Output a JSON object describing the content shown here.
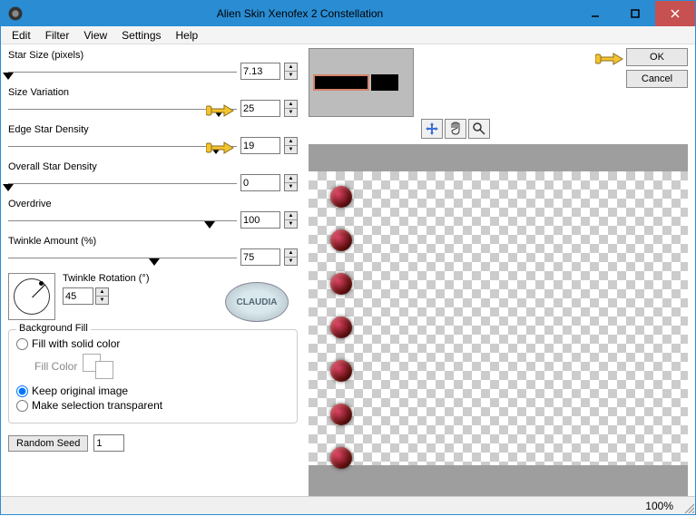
{
  "window": {
    "title": "Alien Skin Xenofex 2 Constellation"
  },
  "menu": {
    "edit": "Edit",
    "filter": "Filter",
    "view": "View",
    "settings": "Settings",
    "help": "Help"
  },
  "sliders": {
    "star_size": {
      "label": "Star Size (pixels)",
      "value": "7.13",
      "pos": 0
    },
    "size_variation": {
      "label": "Size Variation",
      "value": "25",
      "pos": 92
    },
    "edge_density": {
      "label": "Edge Star Density",
      "value": "19",
      "pos": 91
    },
    "overall_density": {
      "label": "Overall Star Density",
      "value": "0",
      "pos": 0
    },
    "overdrive": {
      "label": "Overdrive",
      "value": "100",
      "pos": 88
    },
    "twinkle_amount": {
      "label": "Twinkle Amount (%)",
      "value": "75",
      "pos": 64
    }
  },
  "twinkle_rotation": {
    "label": "Twinkle Rotation (°)",
    "value": "45"
  },
  "claudia": "CLAUDIA",
  "bg_fill": {
    "legend": "Background Fill",
    "solid": "Fill with solid color",
    "fill_color": "Fill Color",
    "keep": "Keep original image",
    "transparent": "Make selection transparent",
    "selected": "keep"
  },
  "random_seed": {
    "button": "Random Seed",
    "value": "1"
  },
  "buttons": {
    "ok": "OK",
    "cancel": "Cancel"
  },
  "status": {
    "zoom": "100%"
  }
}
